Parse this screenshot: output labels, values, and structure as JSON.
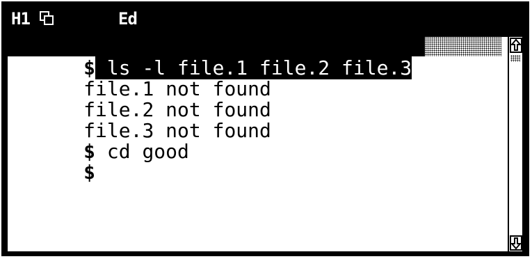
{
  "window": {
    "title_host": "H1",
    "title_mode": "Ed",
    "icons": [
      "window-stack-icon"
    ]
  },
  "terminal": {
    "lines": [
      {
        "prompt": "$",
        "text": " ls -l file.1 file.2 file.3",
        "selected": true
      },
      {
        "prompt": "",
        "text": "file.1 not found"
      },
      {
        "prompt": "",
        "text": "file.2 not found"
      },
      {
        "prompt": "",
        "text": "file.3 not found"
      },
      {
        "prompt": "$",
        "text": " cd good"
      },
      {
        "prompt": "$",
        "text": ""
      }
    ]
  },
  "scrollbar": {
    "icons": [
      "scroll-up-arrow-icon",
      "scroll-down-arrow-icon"
    ]
  },
  "colors": {
    "background": "#ffffff",
    "foreground": "#000000",
    "selection": "#000000"
  }
}
